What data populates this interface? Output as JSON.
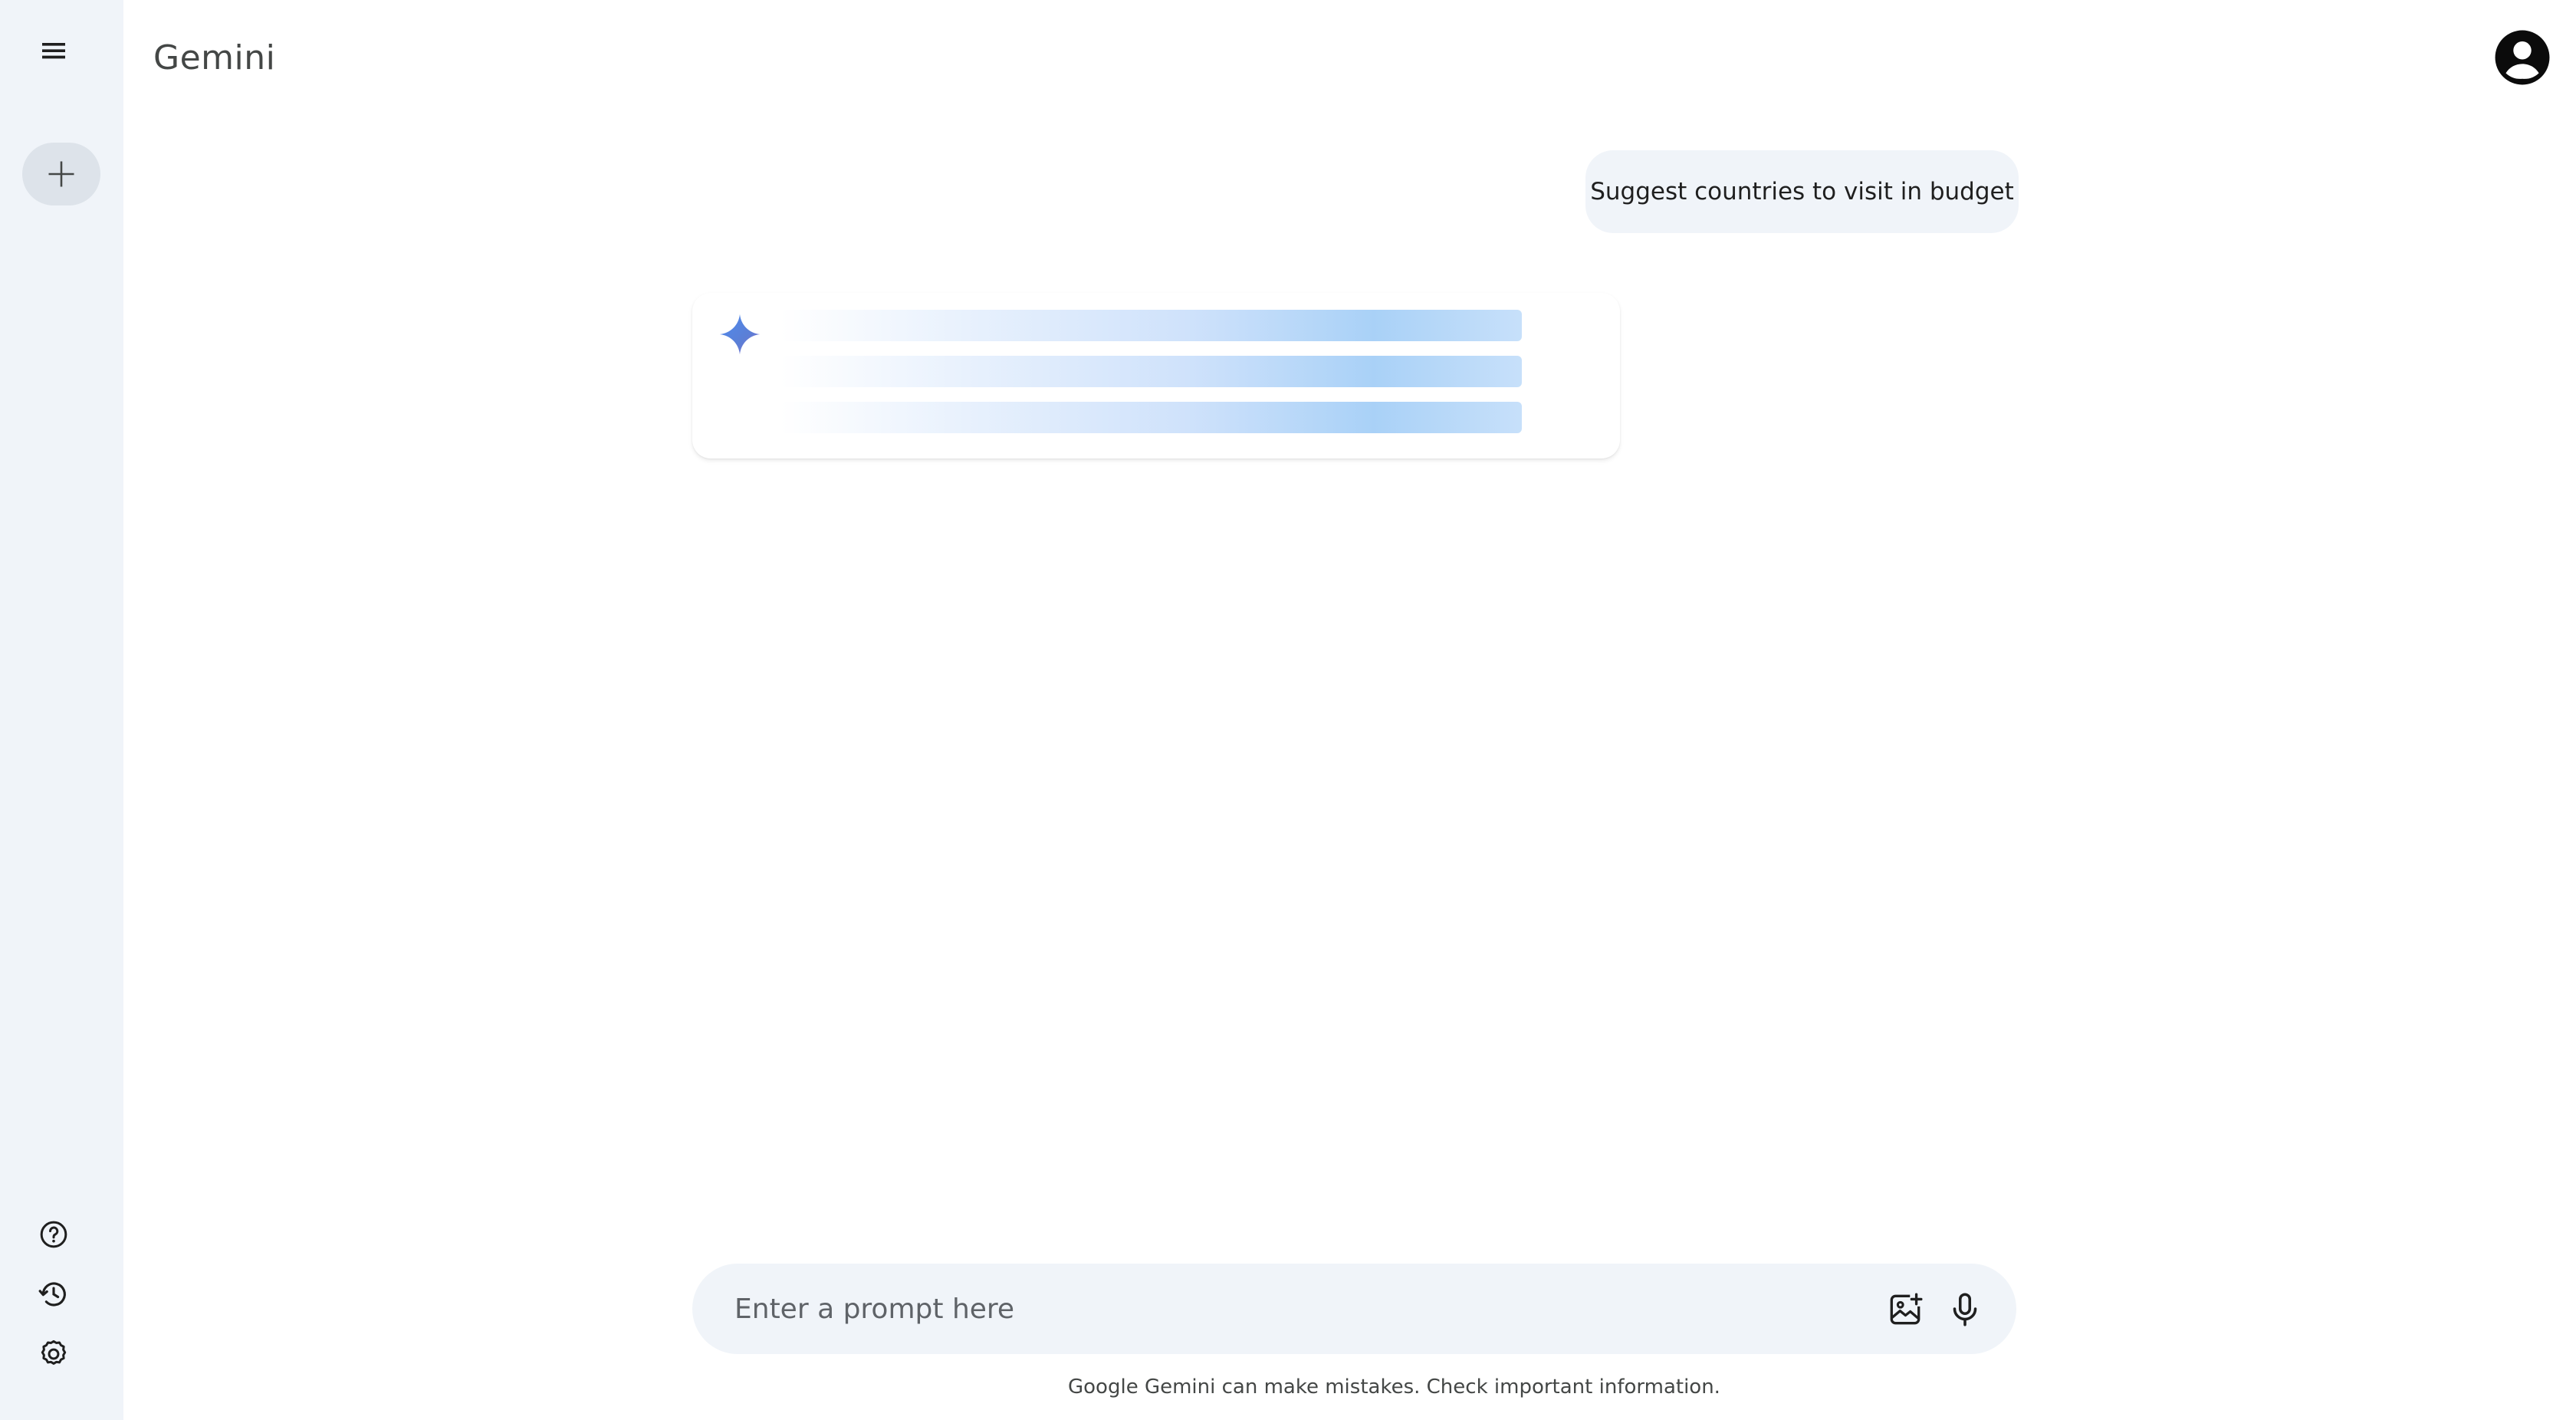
{
  "app": {
    "title": "Gemini"
  },
  "sidebar": {
    "menu_icon": "menu-icon",
    "new_chat_icon": "plus-icon",
    "bottom_items": [
      {
        "icon": "help-icon"
      },
      {
        "icon": "history-icon"
      },
      {
        "icon": "settings-icon"
      }
    ]
  },
  "header": {
    "avatar_icon": "account-circle-icon"
  },
  "conversation": {
    "user_message": "Suggest countries to visit in budget",
    "response_state": "loading",
    "response_icon": "gemini-spark-icon"
  },
  "prompt": {
    "placeholder": "Enter a prompt here",
    "value": "",
    "image_icon": "add-image-icon",
    "mic_icon": "microphone-icon"
  },
  "footer": {
    "disclaimer": "Google Gemini can make mistakes. Check important information."
  },
  "colors": {
    "sidebar_bg": "#f0f4f9",
    "bubble_bg": "#f0f4f9",
    "spark_blue": "#4285f4",
    "text": "#1f1f1f"
  }
}
